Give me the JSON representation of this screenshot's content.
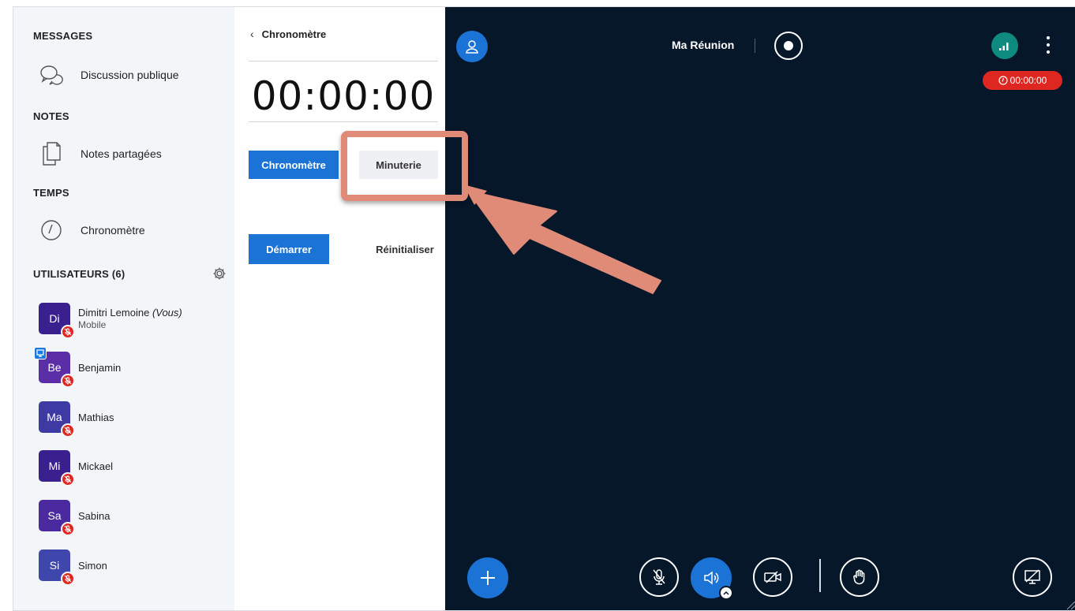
{
  "sidebar": {
    "messages_title": "MESSAGES",
    "public_chat": "Discussion publique",
    "notes_title": "NOTES",
    "shared_notes": "Notes partagées",
    "time_title": "TEMPS",
    "stopwatch": "Chronomètre",
    "users_title": "UTILISATEURS (6)",
    "users": [
      {
        "initials": "Di",
        "name": "Dimitri Lemoine",
        "tag": "(Vous)",
        "sub": "Mobile",
        "color": "#3a1f8f"
      },
      {
        "initials": "Be",
        "name": "Benjamin",
        "color": "#5b2ea8"
      },
      {
        "initials": "Ma",
        "name": "Mathias",
        "color": "#3d3aa3"
      },
      {
        "initials": "Mi",
        "name": "Mickael",
        "color": "#3a1f8f"
      },
      {
        "initials": "Sa",
        "name": "Sabina",
        "color": "#4a2a9e"
      },
      {
        "initials": "Si",
        "name": "Simon",
        "color": "#3f47ad"
      }
    ]
  },
  "panel": {
    "back_label": "Chronomètre",
    "clock": "00:00:00",
    "tab_stopwatch": "Chronomètre",
    "tab_timer": "Minuterie",
    "start": "Démarrer",
    "reset": "Réinitialiser"
  },
  "meeting": {
    "title": "Ma Réunion",
    "timer": "00:00:00"
  },
  "colors": {
    "accent": "#1b73d6",
    "danger": "#df2721",
    "meeting_bg": "#06172a",
    "connection": "#0f8a7e",
    "highlight": "#e08a78"
  }
}
